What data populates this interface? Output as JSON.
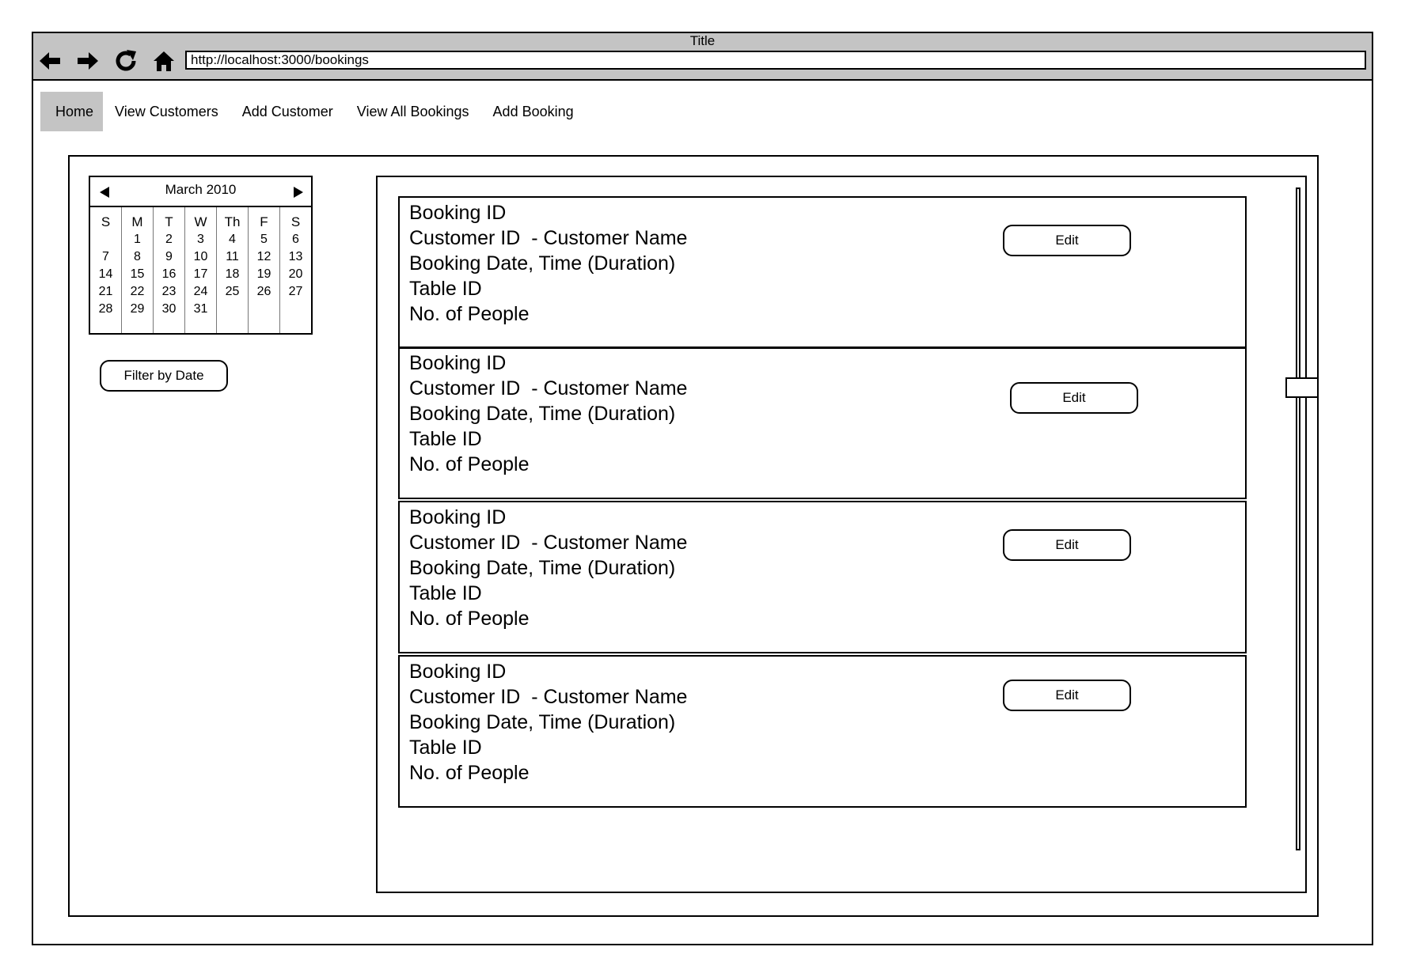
{
  "window": {
    "title": "Title"
  },
  "toolbar": {
    "url": "http://localhost:3000/bookings",
    "buttons": [
      "back-arrow-icon",
      "forward-arrow-icon",
      "reload-icon",
      "home-icon"
    ]
  },
  "nav": {
    "active": "Home",
    "items": [
      "Home",
      "View Customers",
      "Add Customer",
      "View All Bookings",
      "Add Booking"
    ]
  },
  "calendar": {
    "month": "March 2010",
    "columns": [
      {
        "day": "S",
        "dates": [
          "",
          "7",
          "14",
          "21",
          "28"
        ]
      },
      {
        "day": "M",
        "dates": [
          "1",
          "8",
          "15",
          "22",
          "29"
        ]
      },
      {
        "day": "T",
        "dates": [
          "2",
          "9",
          "16",
          "23",
          "30"
        ]
      },
      {
        "day": "W",
        "dates": [
          "3",
          "10",
          "17",
          "24",
          "31"
        ]
      },
      {
        "day": "Th",
        "dates": [
          "4",
          "11",
          "18",
          "25",
          ""
        ]
      },
      {
        "day": "F",
        "dates": [
          "5",
          "12",
          "19",
          "26",
          ""
        ]
      },
      {
        "day": "S",
        "dates": [
          "6",
          "13",
          "20",
          "27",
          ""
        ]
      }
    ]
  },
  "filter": {
    "label": "Filter by Date"
  },
  "bookings": [
    {
      "booking_id": "Booking ID",
      "customer": "Customer ID  - Customer Name",
      "datetime": "Booking Date, Time (Duration)",
      "table": "Table ID",
      "people": "No. of People",
      "edit_label": "Edit"
    },
    {
      "booking_id": "Booking ID",
      "customer": "Customer ID  - Customer Name",
      "datetime": "Booking Date, Time (Duration)",
      "table": "Table ID",
      "people": "No. of People",
      "edit_label": "Edit"
    },
    {
      "booking_id": "Booking ID",
      "customer": "Customer ID  - Customer Name",
      "datetime": "Booking Date, Time (Duration)",
      "table": "Table ID",
      "people": "No. of People",
      "edit_label": "Edit"
    },
    {
      "booking_id": "Booking ID",
      "customer": "Customer ID  - Customer Name",
      "datetime": "Booking Date, Time (Duration)",
      "table": "Table ID",
      "people": "No. of People",
      "edit_label": "Edit"
    }
  ],
  "scrollbar": {
    "position": 0.3
  }
}
